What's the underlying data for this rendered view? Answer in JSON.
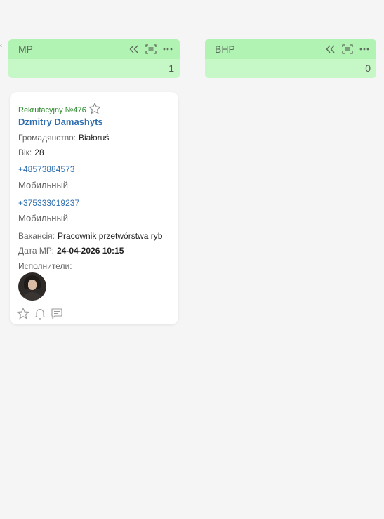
{
  "columns": [
    {
      "title": "МР",
      "count": "1"
    },
    {
      "title": "ВНР",
      "count": "0"
    }
  ],
  "card": {
    "recruitment_number": "Rekrutacyjny №476",
    "candidate_name": "Dzmitry Damashyts",
    "citizenship_label": "Громадянство:",
    "citizenship_value": "Białoruś",
    "age_label": "Вік:",
    "age_value": "28",
    "phones": [
      {
        "number": "+48573884573",
        "type": "Мобильный"
      },
      {
        "number": "+375333019237",
        "type": "Мобильный"
      }
    ],
    "vacancy_label": "Вакансія:",
    "vacancy_value": "Pracownik przetwórstwa ryb",
    "date_label": "Дата МР:",
    "date_value": "24-04-2026 10:15",
    "assignees_label": "Исполнители:"
  },
  "icons": {
    "header": [
      "collapse-left-icon",
      "scan-icon",
      "more-icon"
    ],
    "card_actions": [
      "star-icon",
      "bell-icon",
      "comment-icon"
    ]
  },
  "colors": {
    "header_top": "#b1f3b3",
    "header_bottom": "#c6f7c6",
    "link": "#2f6fb0",
    "recruitment": "#2a8a2a"
  }
}
